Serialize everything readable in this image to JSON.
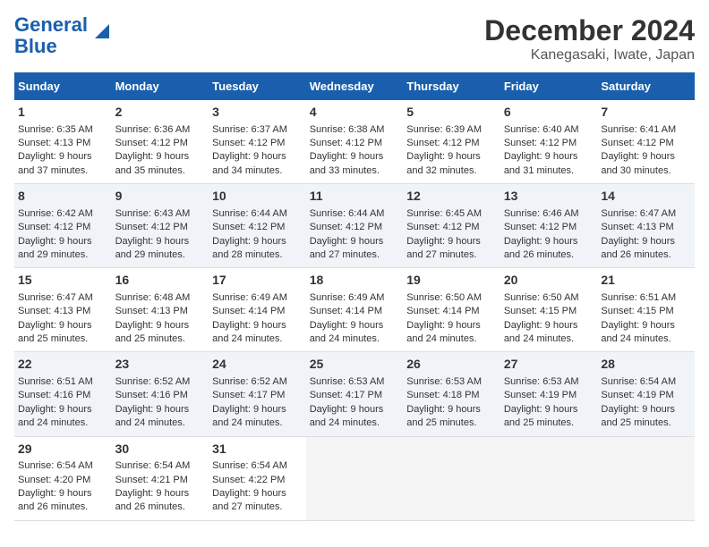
{
  "logo": {
    "line1": "General",
    "line2": "Blue"
  },
  "title": "December 2024",
  "subtitle": "Kanegasaki, Iwate, Japan",
  "days_of_week": [
    "Sunday",
    "Monday",
    "Tuesday",
    "Wednesday",
    "Thursday",
    "Friday",
    "Saturday"
  ],
  "weeks": [
    [
      {
        "day": 1,
        "sunrise": "Sunrise: 6:35 AM",
        "sunset": "Sunset: 4:13 PM",
        "daylight": "Daylight: 9 hours and 37 minutes."
      },
      {
        "day": 2,
        "sunrise": "Sunrise: 6:36 AM",
        "sunset": "Sunset: 4:12 PM",
        "daylight": "Daylight: 9 hours and 35 minutes."
      },
      {
        "day": 3,
        "sunrise": "Sunrise: 6:37 AM",
        "sunset": "Sunset: 4:12 PM",
        "daylight": "Daylight: 9 hours and 34 minutes."
      },
      {
        "day": 4,
        "sunrise": "Sunrise: 6:38 AM",
        "sunset": "Sunset: 4:12 PM",
        "daylight": "Daylight: 9 hours and 33 minutes."
      },
      {
        "day": 5,
        "sunrise": "Sunrise: 6:39 AM",
        "sunset": "Sunset: 4:12 PM",
        "daylight": "Daylight: 9 hours and 32 minutes."
      },
      {
        "day": 6,
        "sunrise": "Sunrise: 6:40 AM",
        "sunset": "Sunset: 4:12 PM",
        "daylight": "Daylight: 9 hours and 31 minutes."
      },
      {
        "day": 7,
        "sunrise": "Sunrise: 6:41 AM",
        "sunset": "Sunset: 4:12 PM",
        "daylight": "Daylight: 9 hours and 30 minutes."
      }
    ],
    [
      {
        "day": 8,
        "sunrise": "Sunrise: 6:42 AM",
        "sunset": "Sunset: 4:12 PM",
        "daylight": "Daylight: 9 hours and 29 minutes."
      },
      {
        "day": 9,
        "sunrise": "Sunrise: 6:43 AM",
        "sunset": "Sunset: 4:12 PM",
        "daylight": "Daylight: 9 hours and 29 minutes."
      },
      {
        "day": 10,
        "sunrise": "Sunrise: 6:44 AM",
        "sunset": "Sunset: 4:12 PM",
        "daylight": "Daylight: 9 hours and 28 minutes."
      },
      {
        "day": 11,
        "sunrise": "Sunrise: 6:44 AM",
        "sunset": "Sunset: 4:12 PM",
        "daylight": "Daylight: 9 hours and 27 minutes."
      },
      {
        "day": 12,
        "sunrise": "Sunrise: 6:45 AM",
        "sunset": "Sunset: 4:12 PM",
        "daylight": "Daylight: 9 hours and 27 minutes."
      },
      {
        "day": 13,
        "sunrise": "Sunrise: 6:46 AM",
        "sunset": "Sunset: 4:12 PM",
        "daylight": "Daylight: 9 hours and 26 minutes."
      },
      {
        "day": 14,
        "sunrise": "Sunrise: 6:47 AM",
        "sunset": "Sunset: 4:13 PM",
        "daylight": "Daylight: 9 hours and 26 minutes."
      }
    ],
    [
      {
        "day": 15,
        "sunrise": "Sunrise: 6:47 AM",
        "sunset": "Sunset: 4:13 PM",
        "daylight": "Daylight: 9 hours and 25 minutes."
      },
      {
        "day": 16,
        "sunrise": "Sunrise: 6:48 AM",
        "sunset": "Sunset: 4:13 PM",
        "daylight": "Daylight: 9 hours and 25 minutes."
      },
      {
        "day": 17,
        "sunrise": "Sunrise: 6:49 AM",
        "sunset": "Sunset: 4:14 PM",
        "daylight": "Daylight: 9 hours and 24 minutes."
      },
      {
        "day": 18,
        "sunrise": "Sunrise: 6:49 AM",
        "sunset": "Sunset: 4:14 PM",
        "daylight": "Daylight: 9 hours and 24 minutes."
      },
      {
        "day": 19,
        "sunrise": "Sunrise: 6:50 AM",
        "sunset": "Sunset: 4:14 PM",
        "daylight": "Daylight: 9 hours and 24 minutes."
      },
      {
        "day": 20,
        "sunrise": "Sunrise: 6:50 AM",
        "sunset": "Sunset: 4:15 PM",
        "daylight": "Daylight: 9 hours and 24 minutes."
      },
      {
        "day": 21,
        "sunrise": "Sunrise: 6:51 AM",
        "sunset": "Sunset: 4:15 PM",
        "daylight": "Daylight: 9 hours and 24 minutes."
      }
    ],
    [
      {
        "day": 22,
        "sunrise": "Sunrise: 6:51 AM",
        "sunset": "Sunset: 4:16 PM",
        "daylight": "Daylight: 9 hours and 24 minutes."
      },
      {
        "day": 23,
        "sunrise": "Sunrise: 6:52 AM",
        "sunset": "Sunset: 4:16 PM",
        "daylight": "Daylight: 9 hours and 24 minutes."
      },
      {
        "day": 24,
        "sunrise": "Sunrise: 6:52 AM",
        "sunset": "Sunset: 4:17 PM",
        "daylight": "Daylight: 9 hours and 24 minutes."
      },
      {
        "day": 25,
        "sunrise": "Sunrise: 6:53 AM",
        "sunset": "Sunset: 4:17 PM",
        "daylight": "Daylight: 9 hours and 24 minutes."
      },
      {
        "day": 26,
        "sunrise": "Sunrise: 6:53 AM",
        "sunset": "Sunset: 4:18 PM",
        "daylight": "Daylight: 9 hours and 25 minutes."
      },
      {
        "day": 27,
        "sunrise": "Sunrise: 6:53 AM",
        "sunset": "Sunset: 4:19 PM",
        "daylight": "Daylight: 9 hours and 25 minutes."
      },
      {
        "day": 28,
        "sunrise": "Sunrise: 6:54 AM",
        "sunset": "Sunset: 4:19 PM",
        "daylight": "Daylight: 9 hours and 25 minutes."
      }
    ],
    [
      {
        "day": 29,
        "sunrise": "Sunrise: 6:54 AM",
        "sunset": "Sunset: 4:20 PM",
        "daylight": "Daylight: 9 hours and 26 minutes."
      },
      {
        "day": 30,
        "sunrise": "Sunrise: 6:54 AM",
        "sunset": "Sunset: 4:21 PM",
        "daylight": "Daylight: 9 hours and 26 minutes."
      },
      {
        "day": 31,
        "sunrise": "Sunrise: 6:54 AM",
        "sunset": "Sunset: 4:22 PM",
        "daylight": "Daylight: 9 hours and 27 minutes."
      },
      null,
      null,
      null,
      null
    ]
  ]
}
